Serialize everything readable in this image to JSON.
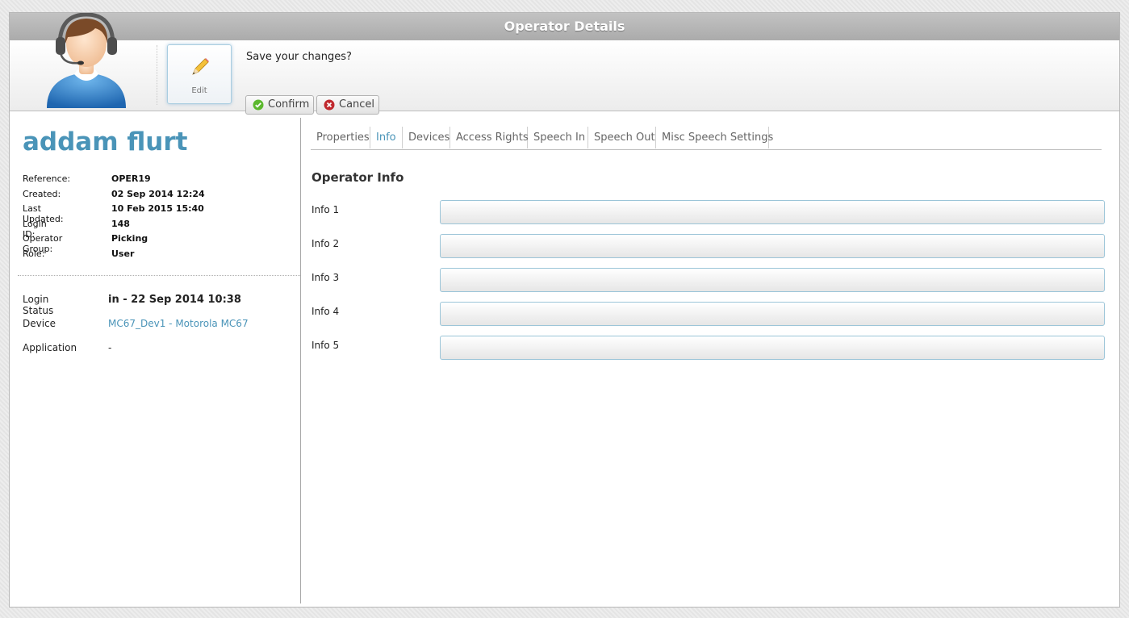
{
  "window": {
    "title": "Operator Details"
  },
  "toolbar": {
    "edit_label": "Edit",
    "save_prompt": "Save your changes?",
    "confirm_label": "Confirm",
    "cancel_label": "Cancel"
  },
  "operator": {
    "name": "addam flurt",
    "details": [
      {
        "label": "Reference:",
        "value": "OPER19"
      },
      {
        "label": "Created:",
        "value": "02 Sep 2014 12:24"
      },
      {
        "label": "Last Updated:",
        "value": "10 Feb 2015 15:40"
      },
      {
        "label": "Login ID:",
        "value": "148"
      },
      {
        "label": "Operator Group:",
        "value": "Picking"
      },
      {
        "label": "Role:",
        "value": "User"
      }
    ],
    "status": {
      "login_status_label": "Login Status",
      "login_status_value": "in - 22 Sep 2014 10:38",
      "device_label": "Device",
      "device_value": "MC67_Dev1 - Motorola MC67",
      "application_label": "Application",
      "application_value": "-"
    }
  },
  "tabs": [
    {
      "label": "Properties"
    },
    {
      "label": "Info",
      "active": true
    },
    {
      "label": "Devices"
    },
    {
      "label": "Access Rights"
    },
    {
      "label": "Speech In"
    },
    {
      "label": "Speech Out"
    },
    {
      "label": "Misc Speech Settings"
    }
  ],
  "info_section": {
    "title": "Operator Info",
    "fields": [
      {
        "label": "Info 1",
        "value": ""
      },
      {
        "label": "Info 2",
        "value": ""
      },
      {
        "label": "Info 3",
        "value": ""
      },
      {
        "label": "Info 4",
        "value": ""
      },
      {
        "label": "Info 5",
        "value": ""
      }
    ]
  },
  "colors": {
    "accent": "#4a94b8",
    "titlebar": "#b3b3b3",
    "confirm_icon": "#5cb82e",
    "cancel_icon": "#c0282d"
  }
}
